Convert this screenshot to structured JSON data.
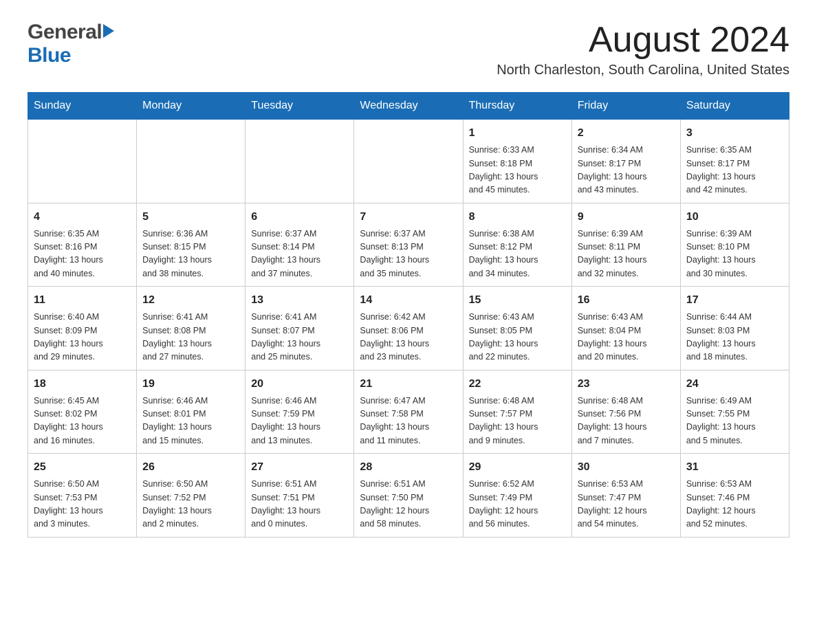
{
  "header": {
    "logo_general": "General",
    "logo_blue": "Blue",
    "month_title": "August 2024",
    "location": "North Charleston, South Carolina, United States"
  },
  "weekdays": [
    "Sunday",
    "Monday",
    "Tuesday",
    "Wednesday",
    "Thursday",
    "Friday",
    "Saturday"
  ],
  "weeks": [
    [
      {
        "day": "",
        "info": ""
      },
      {
        "day": "",
        "info": ""
      },
      {
        "day": "",
        "info": ""
      },
      {
        "day": "",
        "info": ""
      },
      {
        "day": "1",
        "info": "Sunrise: 6:33 AM\nSunset: 8:18 PM\nDaylight: 13 hours\nand 45 minutes."
      },
      {
        "day": "2",
        "info": "Sunrise: 6:34 AM\nSunset: 8:17 PM\nDaylight: 13 hours\nand 43 minutes."
      },
      {
        "day": "3",
        "info": "Sunrise: 6:35 AM\nSunset: 8:17 PM\nDaylight: 13 hours\nand 42 minutes."
      }
    ],
    [
      {
        "day": "4",
        "info": "Sunrise: 6:35 AM\nSunset: 8:16 PM\nDaylight: 13 hours\nand 40 minutes."
      },
      {
        "day": "5",
        "info": "Sunrise: 6:36 AM\nSunset: 8:15 PM\nDaylight: 13 hours\nand 38 minutes."
      },
      {
        "day": "6",
        "info": "Sunrise: 6:37 AM\nSunset: 8:14 PM\nDaylight: 13 hours\nand 37 minutes."
      },
      {
        "day": "7",
        "info": "Sunrise: 6:37 AM\nSunset: 8:13 PM\nDaylight: 13 hours\nand 35 minutes."
      },
      {
        "day": "8",
        "info": "Sunrise: 6:38 AM\nSunset: 8:12 PM\nDaylight: 13 hours\nand 34 minutes."
      },
      {
        "day": "9",
        "info": "Sunrise: 6:39 AM\nSunset: 8:11 PM\nDaylight: 13 hours\nand 32 minutes."
      },
      {
        "day": "10",
        "info": "Sunrise: 6:39 AM\nSunset: 8:10 PM\nDaylight: 13 hours\nand 30 minutes."
      }
    ],
    [
      {
        "day": "11",
        "info": "Sunrise: 6:40 AM\nSunset: 8:09 PM\nDaylight: 13 hours\nand 29 minutes."
      },
      {
        "day": "12",
        "info": "Sunrise: 6:41 AM\nSunset: 8:08 PM\nDaylight: 13 hours\nand 27 minutes."
      },
      {
        "day": "13",
        "info": "Sunrise: 6:41 AM\nSunset: 8:07 PM\nDaylight: 13 hours\nand 25 minutes."
      },
      {
        "day": "14",
        "info": "Sunrise: 6:42 AM\nSunset: 8:06 PM\nDaylight: 13 hours\nand 23 minutes."
      },
      {
        "day": "15",
        "info": "Sunrise: 6:43 AM\nSunset: 8:05 PM\nDaylight: 13 hours\nand 22 minutes."
      },
      {
        "day": "16",
        "info": "Sunrise: 6:43 AM\nSunset: 8:04 PM\nDaylight: 13 hours\nand 20 minutes."
      },
      {
        "day": "17",
        "info": "Sunrise: 6:44 AM\nSunset: 8:03 PM\nDaylight: 13 hours\nand 18 minutes."
      }
    ],
    [
      {
        "day": "18",
        "info": "Sunrise: 6:45 AM\nSunset: 8:02 PM\nDaylight: 13 hours\nand 16 minutes."
      },
      {
        "day": "19",
        "info": "Sunrise: 6:46 AM\nSunset: 8:01 PM\nDaylight: 13 hours\nand 15 minutes."
      },
      {
        "day": "20",
        "info": "Sunrise: 6:46 AM\nSunset: 7:59 PM\nDaylight: 13 hours\nand 13 minutes."
      },
      {
        "day": "21",
        "info": "Sunrise: 6:47 AM\nSunset: 7:58 PM\nDaylight: 13 hours\nand 11 minutes."
      },
      {
        "day": "22",
        "info": "Sunrise: 6:48 AM\nSunset: 7:57 PM\nDaylight: 13 hours\nand 9 minutes."
      },
      {
        "day": "23",
        "info": "Sunrise: 6:48 AM\nSunset: 7:56 PM\nDaylight: 13 hours\nand 7 minutes."
      },
      {
        "day": "24",
        "info": "Sunrise: 6:49 AM\nSunset: 7:55 PM\nDaylight: 13 hours\nand 5 minutes."
      }
    ],
    [
      {
        "day": "25",
        "info": "Sunrise: 6:50 AM\nSunset: 7:53 PM\nDaylight: 13 hours\nand 3 minutes."
      },
      {
        "day": "26",
        "info": "Sunrise: 6:50 AM\nSunset: 7:52 PM\nDaylight: 13 hours\nand 2 minutes."
      },
      {
        "day": "27",
        "info": "Sunrise: 6:51 AM\nSunset: 7:51 PM\nDaylight: 13 hours\nand 0 minutes."
      },
      {
        "day": "28",
        "info": "Sunrise: 6:51 AM\nSunset: 7:50 PM\nDaylight: 12 hours\nand 58 minutes."
      },
      {
        "day": "29",
        "info": "Sunrise: 6:52 AM\nSunset: 7:49 PM\nDaylight: 12 hours\nand 56 minutes."
      },
      {
        "day": "30",
        "info": "Sunrise: 6:53 AM\nSunset: 7:47 PM\nDaylight: 12 hours\nand 54 minutes."
      },
      {
        "day": "31",
        "info": "Sunrise: 6:53 AM\nSunset: 7:46 PM\nDaylight: 12 hours\nand 52 minutes."
      }
    ]
  ]
}
